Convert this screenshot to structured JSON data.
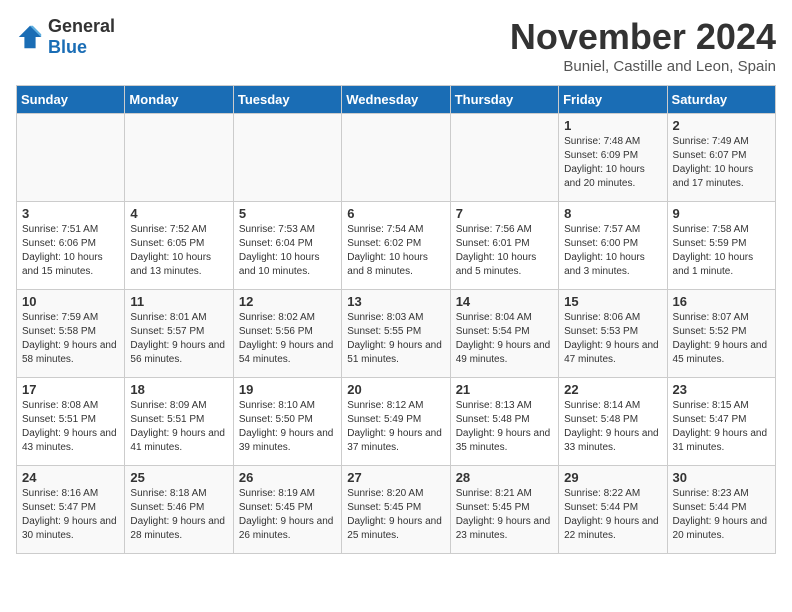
{
  "logo": {
    "general": "General",
    "blue": "Blue"
  },
  "title": "November 2024",
  "location": "Buniel, Castille and Leon, Spain",
  "days_of_week": [
    "Sunday",
    "Monday",
    "Tuesday",
    "Wednesday",
    "Thursday",
    "Friday",
    "Saturday"
  ],
  "weeks": [
    [
      {
        "day": "",
        "info": ""
      },
      {
        "day": "",
        "info": ""
      },
      {
        "day": "",
        "info": ""
      },
      {
        "day": "",
        "info": ""
      },
      {
        "day": "",
        "info": ""
      },
      {
        "day": "1",
        "info": "Sunrise: 7:48 AM\nSunset: 6:09 PM\nDaylight: 10 hours and 20 minutes."
      },
      {
        "day": "2",
        "info": "Sunrise: 7:49 AM\nSunset: 6:07 PM\nDaylight: 10 hours and 17 minutes."
      }
    ],
    [
      {
        "day": "3",
        "info": "Sunrise: 7:51 AM\nSunset: 6:06 PM\nDaylight: 10 hours and 15 minutes."
      },
      {
        "day": "4",
        "info": "Sunrise: 7:52 AM\nSunset: 6:05 PM\nDaylight: 10 hours and 13 minutes."
      },
      {
        "day": "5",
        "info": "Sunrise: 7:53 AM\nSunset: 6:04 PM\nDaylight: 10 hours and 10 minutes."
      },
      {
        "day": "6",
        "info": "Sunrise: 7:54 AM\nSunset: 6:02 PM\nDaylight: 10 hours and 8 minutes."
      },
      {
        "day": "7",
        "info": "Sunrise: 7:56 AM\nSunset: 6:01 PM\nDaylight: 10 hours and 5 minutes."
      },
      {
        "day": "8",
        "info": "Sunrise: 7:57 AM\nSunset: 6:00 PM\nDaylight: 10 hours and 3 minutes."
      },
      {
        "day": "9",
        "info": "Sunrise: 7:58 AM\nSunset: 5:59 PM\nDaylight: 10 hours and 1 minute."
      }
    ],
    [
      {
        "day": "10",
        "info": "Sunrise: 7:59 AM\nSunset: 5:58 PM\nDaylight: 9 hours and 58 minutes."
      },
      {
        "day": "11",
        "info": "Sunrise: 8:01 AM\nSunset: 5:57 PM\nDaylight: 9 hours and 56 minutes."
      },
      {
        "day": "12",
        "info": "Sunrise: 8:02 AM\nSunset: 5:56 PM\nDaylight: 9 hours and 54 minutes."
      },
      {
        "day": "13",
        "info": "Sunrise: 8:03 AM\nSunset: 5:55 PM\nDaylight: 9 hours and 51 minutes."
      },
      {
        "day": "14",
        "info": "Sunrise: 8:04 AM\nSunset: 5:54 PM\nDaylight: 9 hours and 49 minutes."
      },
      {
        "day": "15",
        "info": "Sunrise: 8:06 AM\nSunset: 5:53 PM\nDaylight: 9 hours and 47 minutes."
      },
      {
        "day": "16",
        "info": "Sunrise: 8:07 AM\nSunset: 5:52 PM\nDaylight: 9 hours and 45 minutes."
      }
    ],
    [
      {
        "day": "17",
        "info": "Sunrise: 8:08 AM\nSunset: 5:51 PM\nDaylight: 9 hours and 43 minutes."
      },
      {
        "day": "18",
        "info": "Sunrise: 8:09 AM\nSunset: 5:51 PM\nDaylight: 9 hours and 41 minutes."
      },
      {
        "day": "19",
        "info": "Sunrise: 8:10 AM\nSunset: 5:50 PM\nDaylight: 9 hours and 39 minutes."
      },
      {
        "day": "20",
        "info": "Sunrise: 8:12 AM\nSunset: 5:49 PM\nDaylight: 9 hours and 37 minutes."
      },
      {
        "day": "21",
        "info": "Sunrise: 8:13 AM\nSunset: 5:48 PM\nDaylight: 9 hours and 35 minutes."
      },
      {
        "day": "22",
        "info": "Sunrise: 8:14 AM\nSunset: 5:48 PM\nDaylight: 9 hours and 33 minutes."
      },
      {
        "day": "23",
        "info": "Sunrise: 8:15 AM\nSunset: 5:47 PM\nDaylight: 9 hours and 31 minutes."
      }
    ],
    [
      {
        "day": "24",
        "info": "Sunrise: 8:16 AM\nSunset: 5:47 PM\nDaylight: 9 hours and 30 minutes."
      },
      {
        "day": "25",
        "info": "Sunrise: 8:18 AM\nSunset: 5:46 PM\nDaylight: 9 hours and 28 minutes."
      },
      {
        "day": "26",
        "info": "Sunrise: 8:19 AM\nSunset: 5:45 PM\nDaylight: 9 hours and 26 minutes."
      },
      {
        "day": "27",
        "info": "Sunrise: 8:20 AM\nSunset: 5:45 PM\nDaylight: 9 hours and 25 minutes."
      },
      {
        "day": "28",
        "info": "Sunrise: 8:21 AM\nSunset: 5:45 PM\nDaylight: 9 hours and 23 minutes."
      },
      {
        "day": "29",
        "info": "Sunrise: 8:22 AM\nSunset: 5:44 PM\nDaylight: 9 hours and 22 minutes."
      },
      {
        "day": "30",
        "info": "Sunrise: 8:23 AM\nSunset: 5:44 PM\nDaylight: 9 hours and 20 minutes."
      }
    ]
  ]
}
